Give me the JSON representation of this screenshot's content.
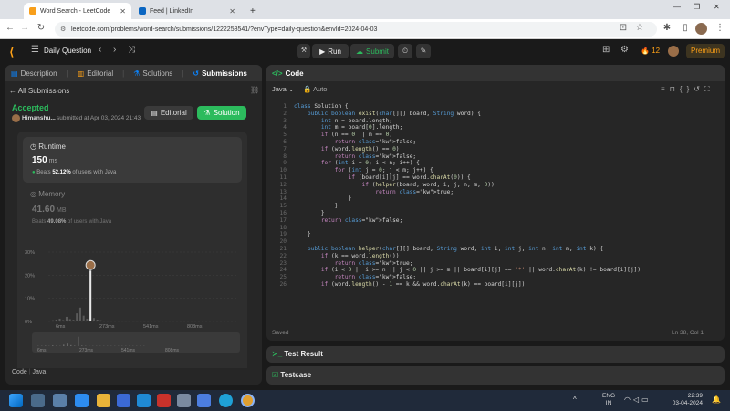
{
  "browser": {
    "tabs": [
      {
        "title": "Word Search - LeetCode",
        "active": true
      },
      {
        "title": "Feed | LinkedIn",
        "active": false
      }
    ],
    "url": "leetcode.com/problems/word-search/submissions/1222258541/?envType=daily-question&envId=2024-04-03"
  },
  "topbar": {
    "daily_label": "Daily Question",
    "run_label": "Run",
    "submit_label": "Submit",
    "streak": "12",
    "premium_label": "Premium"
  },
  "left": {
    "tabs": [
      "Description",
      "Editorial",
      "Solutions",
      "Submissions"
    ],
    "all_submissions": "All Submissions",
    "status": "Accepted",
    "user": "Himanshu...",
    "submitted_at": "submitted at Apr 03, 2024 21:43",
    "editorial_btn": "Editorial",
    "solution_btn": "Solution",
    "runtime": {
      "label": "Runtime",
      "value": "150",
      "unit": "ms",
      "beats_prefix": "Beats",
      "beats_pct": "52.12%",
      "beats_suffix": "of users with Java"
    },
    "memory": {
      "label": "Memory",
      "value": "41.60",
      "unit": "MB",
      "beats_prefix": "Beats",
      "beats_pct": "49.08%",
      "beats_suffix": "of users with Java"
    },
    "code_label": "Code",
    "lang_label": "Java"
  },
  "chart_data": {
    "type": "bar",
    "y_ticks": [
      "30%",
      "20%",
      "10%",
      "0%"
    ],
    "x_ticks": [
      "6ms",
      "273ms",
      "541ms",
      "808ms"
    ],
    "ylim": [
      0,
      30
    ],
    "values": [
      0.5,
      0.8,
      1.2,
      0.6,
      2.0,
      1.0,
      0.7,
      3.5,
      6.0,
      2.5,
      1.2,
      22.0,
      1.5,
      0.8,
      0.5,
      0.3,
      0.4,
      0.2,
      0.3,
      0.2,
      0.2,
      0.1,
      0.1,
      0.2,
      0.1,
      0.1,
      0.1,
      0.1,
      0.1,
      0.1
    ],
    "highlight_index": 11
  },
  "editor": {
    "title": "Code",
    "lang": "Java",
    "mode": "Auto",
    "saved": "Saved",
    "cursor": "Ln 38, Col 1",
    "lines": [
      "class Solution {",
      "    public boolean exist(char[][] board, String word) {",
      "        int n = board.length;",
      "        int m = board[0].length;",
      "        if (n == 0 || m == 0)",
      "            return false;",
      "        if (word.length() == 0)",
      "            return false;",
      "        for (int i = 0; i < n; i++) {",
      "            for (int j = 0; j < m; j++) {",
      "                if (board[i][j] == word.charAt(0)) {",
      "                    if (helper(board, word, i, j, n, m, 0))",
      "                        return true;",
      "                }",
      "            }",
      "        }",
      "        return false;",
      "",
      "    }",
      "",
      "    public boolean helper(char[][] board, String word, int i, int j, int n, int m, int k) {",
      "        if (k == word.length())",
      "            return true;",
      "        if (i < 0 || i >= n || j < 0 || j >= m || board[i][j] == '*' || word.charAt(k) != board[i][j])",
      "            return false;",
      "        if (word.length() - 1 == k && word.charAt(k) == board[i][j])"
    ]
  },
  "bottom": {
    "test_result": "Test Result",
    "testcase": "Testcase"
  },
  "taskbar": {
    "lang": "ENG",
    "region": "IN",
    "time": "22:39",
    "date": "03-04-2024"
  }
}
